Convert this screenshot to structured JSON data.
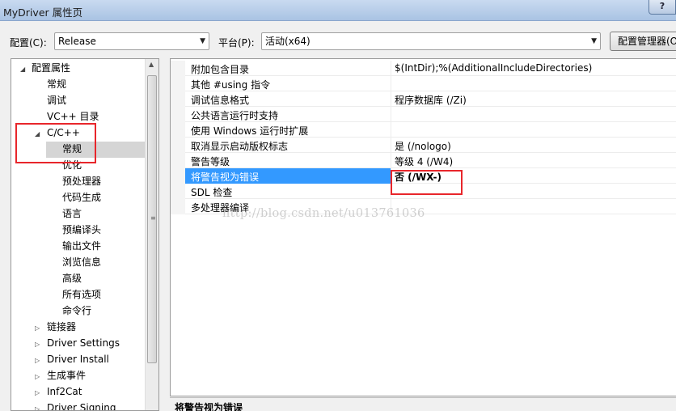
{
  "window": {
    "title": "MyDriver 属性页",
    "help_label": "?"
  },
  "toolbar": {
    "config_label": "配置(C):",
    "config_value": "Release",
    "platform_label": "平台(P):",
    "platform_value": "活动(x64)",
    "config_manager_label": "配置管理器(O"
  },
  "tree": {
    "root": "配置属性",
    "items": [
      "常规",
      "调试",
      "VC++ 目录",
      "C/C++"
    ],
    "cpp_children": [
      "常规",
      "优化",
      "预处理器",
      "代码生成",
      "语言",
      "预编译头",
      "输出文件",
      "浏览信息",
      "高级",
      "所有选项",
      "命令行"
    ],
    "collapsed": [
      "链接器",
      "Driver Settings",
      "Driver Install",
      "生成事件",
      "Inf2Cat",
      "Driver Signing"
    ],
    "selected": "常规"
  },
  "properties": [
    {
      "name": "附加包含目录",
      "value": "$(IntDir);%(AdditionalIncludeDirectories)"
    },
    {
      "name": "其他 #using 指令",
      "value": ""
    },
    {
      "name": "调试信息格式",
      "value": "程序数据库 (/Zi)"
    },
    {
      "name": "公共语言运行时支持",
      "value": ""
    },
    {
      "name": "使用 Windows 运行时扩展",
      "value": ""
    },
    {
      "name": "取消显示启动版权标志",
      "value": "是 (/nologo)"
    },
    {
      "name": "警告等级",
      "value": "等级 4 (/W4)"
    },
    {
      "name": "将警告视为错误",
      "value": "否 (/WX-)"
    },
    {
      "name": "SDL 检查",
      "value": ""
    },
    {
      "name": "多处理器编译",
      "value": ""
    }
  ],
  "description": {
    "title": "将警告视为错误"
  },
  "watermark": "http://blog.csdn.net/u013761036",
  "colors": {
    "selection": "#3399ff",
    "annotation": "#e8262b",
    "tree_selection": "#d5d5d5"
  }
}
